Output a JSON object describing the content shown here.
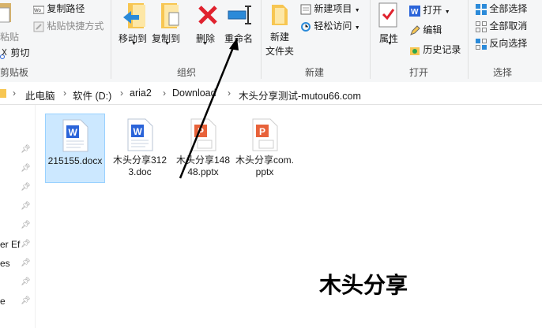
{
  "ribbon": {
    "clipboard": {
      "paste_label": "粘贴",
      "cut_label": "剪切",
      "copy_path_label": "复制路径",
      "paste_shortcut_label": "粘贴快捷方式",
      "group_label": "剪贴板"
    },
    "organize": {
      "move_to_label": "移动到",
      "copy_to_label": "复制到",
      "delete_label": "删除",
      "rename_label": "重命名",
      "group_label": "组织"
    },
    "new": {
      "new_item_label": "新建项目",
      "easy_access_label": "轻松访问",
      "new_folder_label_1": "新建",
      "new_folder_label_2": "文件夹",
      "group_label": "新建"
    },
    "open": {
      "properties_label": "属性",
      "open_label": "打开",
      "edit_label": "编辑",
      "history_label": "历史记录",
      "group_label": "打开"
    },
    "select": {
      "select_all_label": "全部选择",
      "select_none_label": "全部取消",
      "invert_label": "反向选择",
      "group_label": "选择"
    }
  },
  "address": {
    "crumbs": [
      "此电脑",
      "软件 (D:)",
      "aria2",
      "Download",
      "木头分享测试-mutou66.com"
    ]
  },
  "nav": {
    "items": [
      "er Ef",
      "es",
      "",
      "e"
    ]
  },
  "files": [
    {
      "name": "215155.docx",
      "type": "word",
      "selected": true
    },
    {
      "name": "木头分享3123.doc",
      "type": "word",
      "selected": false
    },
    {
      "name": "木头分享14848.pptx",
      "type": "ppt",
      "selected": false
    },
    {
      "name": "木头分享com.pptx",
      "type": "ppt",
      "selected": false
    }
  ],
  "watermark": "木头分享",
  "colors": {
    "word_blue": "#2b64d9",
    "ppt_orange": "#e8623a",
    "delete_red": "#e0222e",
    "folder_yellow": "#f7c652",
    "selection_bg": "#cce8ff"
  }
}
